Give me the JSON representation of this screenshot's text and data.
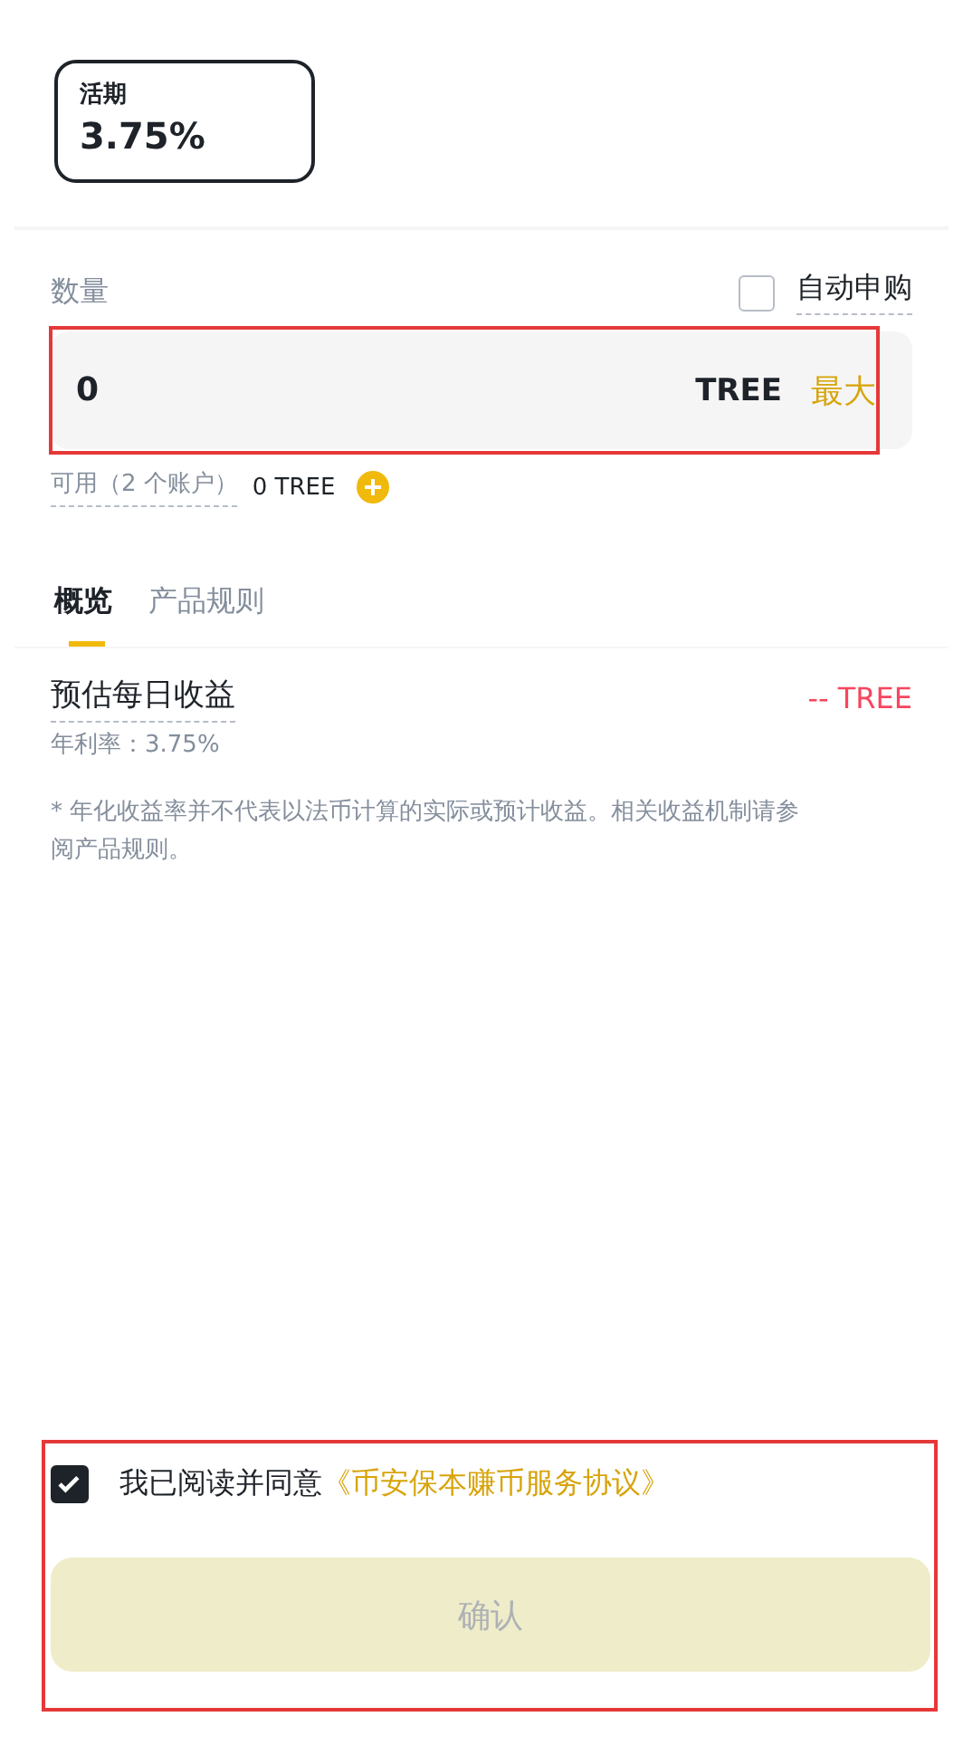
{
  "term_card": {
    "label": "活期",
    "rate": "3.75%",
    "selected": true
  },
  "amount": {
    "label": "数量",
    "auto_subscribe": {
      "label": "自动申购",
      "checked": false
    },
    "value": "0",
    "unit": "TREE",
    "max_label": "最大",
    "highlighted": true
  },
  "available": {
    "label": "可用（2 个账户）",
    "value": "0 TREE"
  },
  "tabs": [
    {
      "label": "概览",
      "selected": true
    },
    {
      "label": "产品规则",
      "selected": false
    }
  ],
  "estimate": {
    "label": "预估每日收益",
    "value": "-- TREE",
    "rate": "年利率：3.75%"
  },
  "note": "*  年化收益率并不代表以法币计算的实际或预计收益。相关收益机制请参阅产品规则。",
  "agreement": {
    "text": "我已阅读并同意",
    "link": "《币安保本赚币服务协议》",
    "checked": true,
    "highlighted": true
  },
  "confirm": {
    "label": "确认",
    "disabled": true
  }
}
